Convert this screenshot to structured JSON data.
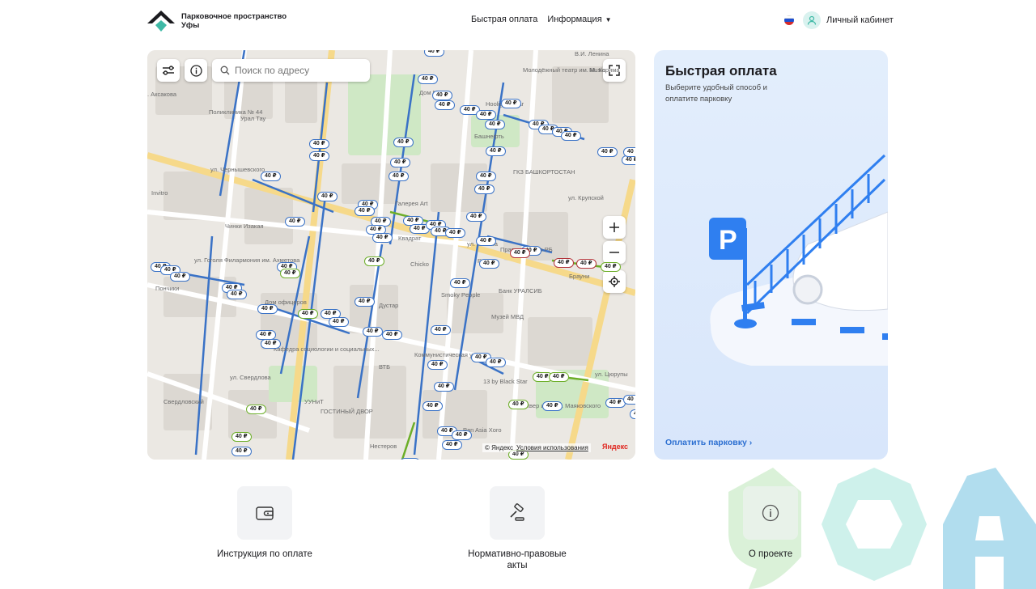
{
  "header": {
    "logo_text": "Парковочное пространство Уфы",
    "nav": {
      "quick_pay": "Быстрая оплата",
      "info": "Информация"
    },
    "cabinet": "Личный кабинет"
  },
  "map": {
    "search_placeholder": "Поиск по адресу",
    "copyright": "© Яндекс",
    "terms": "Условия использования",
    "brand": "Яндекс",
    "price_label": "40 ₽",
    "labels": [
      "В.И. Ленина",
      "Молодёжный театр им. М. Карима",
      "Music",
      "Дом Мамы",
      "Hooligans Bar",
      "Поликлиника № 44",
      "Урал Тау",
      "Башнефть",
      "ГКЗ БАШКОРТОСТАН",
      "ул. Чернышевского",
      "Invitro",
      "Галерея Art",
      "Чинки Изакая",
      "Квадрат",
      "Филармония им. Ахметова",
      "Правительство РБ",
      "Родина",
      "Брауни",
      "Chicko",
      "Smoky People",
      "Банк УРАЛСИБ",
      "Музей МВД",
      "Дом офицеров",
      "Дустар",
      "Кафедра социологии и социальных...",
      "ВТБ",
      "Коммунистическая ул.",
      "ул. Свердлова",
      "УУНиТ",
      "13 by Black Star",
      "Свердловский",
      "ГОСТИНЫЙ ДВОР",
      "сквер им. В.В. Маяковского",
      "Pan Asia Xoro",
      "Нестеров",
      "ул. Цюрупы",
      "ул. Гоголя",
      "ул. Ленина",
      "ул. Крупской",
      "ул. Аксакова",
      "Пончики"
    ]
  },
  "quick_pay": {
    "title": "Быстрая оплата",
    "subtitle": "Выберите удобный способ и оплатите парковку",
    "link": "Оплатить парковку",
    "sign": "P"
  },
  "tiles": [
    {
      "label": "Инструкция по оплате"
    },
    {
      "label": "Нормативно-правовые акты"
    },
    {
      "label": "О проекте"
    }
  ],
  "colors": {
    "accent": "#2c6fd1",
    "brand_teal": "#3fb9a6",
    "price_blue": "#3a72c6",
    "price_green": "#6cae28",
    "price_red": "#b3343a"
  }
}
